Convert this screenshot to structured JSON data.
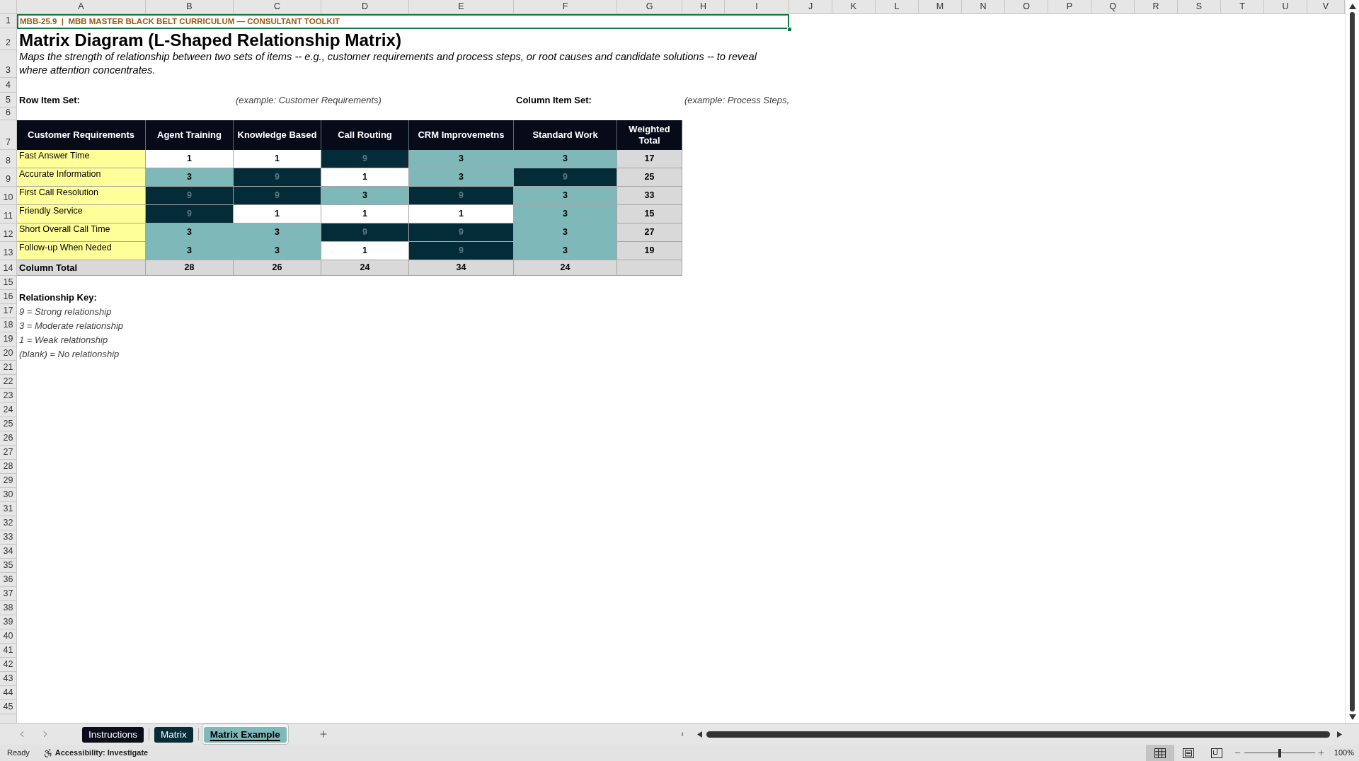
{
  "column_headers": [
    "A",
    "B",
    "C",
    "D",
    "E",
    "F",
    "G",
    "H",
    "I",
    "J",
    "K",
    "L",
    "M",
    "N",
    "O",
    "P",
    "Q",
    "R",
    "S",
    "T",
    "U",
    "V"
  ],
  "row_numbers": [
    "1",
    "2",
    "3",
    "4",
    "5",
    "6",
    "7",
    "8",
    "9",
    "10",
    "11",
    "12",
    "13",
    "14",
    "15",
    "16",
    "17",
    "18",
    "19",
    "20",
    "21",
    "22",
    "23",
    "24",
    "25",
    "26",
    "27",
    "28",
    "29",
    "30",
    "31",
    "32",
    "33",
    "34",
    "35",
    "36",
    "37",
    "38",
    "39",
    "40",
    "41",
    "42",
    "43",
    "44",
    "45"
  ],
  "banner": {
    "text": "MBB-25.9  |  MBB MASTER BLACK BELT CURRICULUM — CONSULTANT TOOLKIT",
    "selected": true
  },
  "title": "Matrix Diagram (L-Shaped Relationship Matrix)",
  "description": "Maps the strength of relationship between two sets of items -- e.g., customer requirements and process steps, or root causes and candidate solutions -- to reveal where attention concentrates.",
  "item_sets": [
    {
      "label": "Row Item Set:",
      "example": "(example: Customer Requirements)"
    },
    {
      "label": "Column Item Set:",
      "example": "(example: Process Steps,"
    }
  ],
  "matrix": {
    "row_heading": "Customer Requirements",
    "columns": [
      "Agent Training",
      "Knowledge Based",
      "Call Routing",
      "CRM Improvemetns",
      "Standard Work"
    ],
    "total_heading": "Weighted Total",
    "rows": [
      {
        "label": "Fast Answer Time",
        "cells": [
          {
            "value": "1",
            "color": "#ffffff"
          },
          {
            "value": "1",
            "color": "#ffffff"
          },
          {
            "value": "9",
            "color": "#032b38"
          },
          {
            "value": "3",
            "color": "#7fb8b9"
          },
          {
            "value": "3",
            "color": "#7fb8b9"
          }
        ],
        "total": "17"
      },
      {
        "label": "Accurate Information",
        "cells": [
          {
            "value": "3",
            "color": "#7fb8b9"
          },
          {
            "value": "9",
            "color": "#032b38"
          },
          {
            "value": "1",
            "color": "#ffffff"
          },
          {
            "value": "3",
            "color": "#7fb8b9"
          },
          {
            "value": "9",
            "color": "#032b38"
          }
        ],
        "total": "25"
      },
      {
        "label": "First Call Resolution",
        "cells": [
          {
            "value": "9",
            "color": "#032b38"
          },
          {
            "value": "9",
            "color": "#032b38"
          },
          {
            "value": "3",
            "color": "#7fb8b9"
          },
          {
            "value": "9",
            "color": "#032b38"
          },
          {
            "value": "3",
            "color": "#7fb8b9"
          }
        ],
        "total": "33"
      },
      {
        "label": "Friendly Service",
        "cells": [
          {
            "value": "9",
            "color": "#032b38"
          },
          {
            "value": "1",
            "color": "#ffffff"
          },
          {
            "value": "1",
            "color": "#ffffff"
          },
          {
            "value": "1",
            "color": "#ffffff"
          },
          {
            "value": "3",
            "color": "#7fb8b9"
          }
        ],
        "total": "15"
      },
      {
        "label": "Short Overall Call Time",
        "cells": [
          {
            "value": "3",
            "color": "#7fb8b9"
          },
          {
            "value": "3",
            "color": "#7fb8b9"
          },
          {
            "value": "9",
            "color": "#032b38"
          },
          {
            "value": "9",
            "color": "#032b38"
          },
          {
            "value": "3",
            "color": "#7fb8b9"
          }
        ],
        "total": "27"
      },
      {
        "label": "Follow-up When Neded",
        "cells": [
          {
            "value": "3",
            "color": "#7fb8b9"
          },
          {
            "value": "3",
            "color": "#7fb8b9"
          },
          {
            "value": "1",
            "color": "#ffffff"
          },
          {
            "value": "9",
            "color": "#032b38"
          },
          {
            "value": "3",
            "color": "#7fb8b9"
          }
        ],
        "total": "19"
      }
    ],
    "footer": {
      "label": "Column Total",
      "totals": [
        "28",
        "26",
        "24",
        "34",
        "24"
      ]
    }
  },
  "relationship_key": {
    "title": "Relationship Key:",
    "items": [
      "9 = Strong relationship",
      "3 = Moderate relationship",
      "1 = Weak relationship",
      "(blank) = No relationship"
    ]
  },
  "sheet_tabs": [
    {
      "label": "Instructions",
      "color": "#0a0e1c",
      "selected": false
    },
    {
      "label": "Matrix",
      "color": "#062c38",
      "selected": false
    },
    {
      "label": "Matrix Example",
      "color": "#7fb8b9",
      "selected": true
    }
  ],
  "status_bar": {
    "mode": "Ready",
    "accessibility": "Accessibility: Investigate",
    "views": [
      {
        "kind": "normal",
        "selected": true
      },
      {
        "kind": "page_layout",
        "selected": false
      },
      {
        "kind": "page_break_preview",
        "selected": false
      }
    ],
    "zoom": {
      "level": 0.5,
      "reading": "100%"
    }
  }
}
